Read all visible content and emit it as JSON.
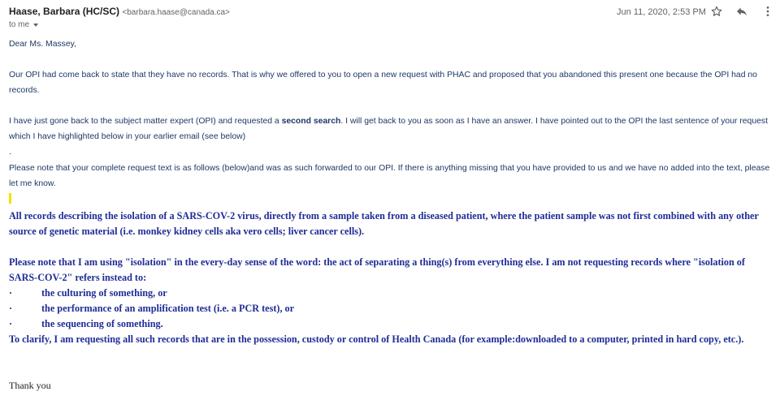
{
  "sender": {
    "name": "Haase, Barbara (HC/SC)",
    "email": "<barbara.haase@canada.ca>",
    "recipient_label": "to me"
  },
  "date": "Jun 11, 2020, 2:53 PM",
  "icons": {
    "star": "star-icon",
    "reply": "reply-icon",
    "more": "more-vert-icon"
  },
  "body": {
    "greeting": "Dear Ms. Massey,",
    "para1": "Our OPI had come back to state that they have no records. That is why we offered to you to open a new request with PHAC and proposed that you abandoned this present one because the OPI had no records.",
    "para2_before": "I have just gone back to the subject matter expert (OPI) and requested a ",
    "para2_bold": "second search",
    "para2_after": ". I will get back to you as soon as I have an answer. I have pointed out to the OPI the last sentence of your request which I have highlighted below in your earlier email (see below)",
    "dot_line": ".",
    "para3": "Please note that your complete request text is as follows (below)and was as such forwarded to our OPI. If there is anything missing that you have provided to us and we have no added into the text, please let me know."
  },
  "request": {
    "para1": "All records describing the isolation of a SARS-COV-2 virus, directly from a sample taken from a diseased patient, where the patient sample was not first combined with any other source of genetic material (i.e. monkey kidney cells aka vero cells; liver cancer cells).",
    "para2": "Please note that I am using \"isolation\" in the every-day sense of the word: the act of separating a thing(s) from everything else.  I am not requesting records where \"isolation of SARS-COV-2\" refers instead to:",
    "bullet_char": "·",
    "bullets": [
      "the culturing of something, or",
      "the performance of an amplification test (i.e. a PCR test), or",
      "the sequencing of something."
    ],
    "para3": "To clarify, I am requesting all such records that are in the possession, custody or control of Health Canada (for example:downloaded to a computer, printed in hard copy, etc.)."
  },
  "closing": "Thank you"
}
